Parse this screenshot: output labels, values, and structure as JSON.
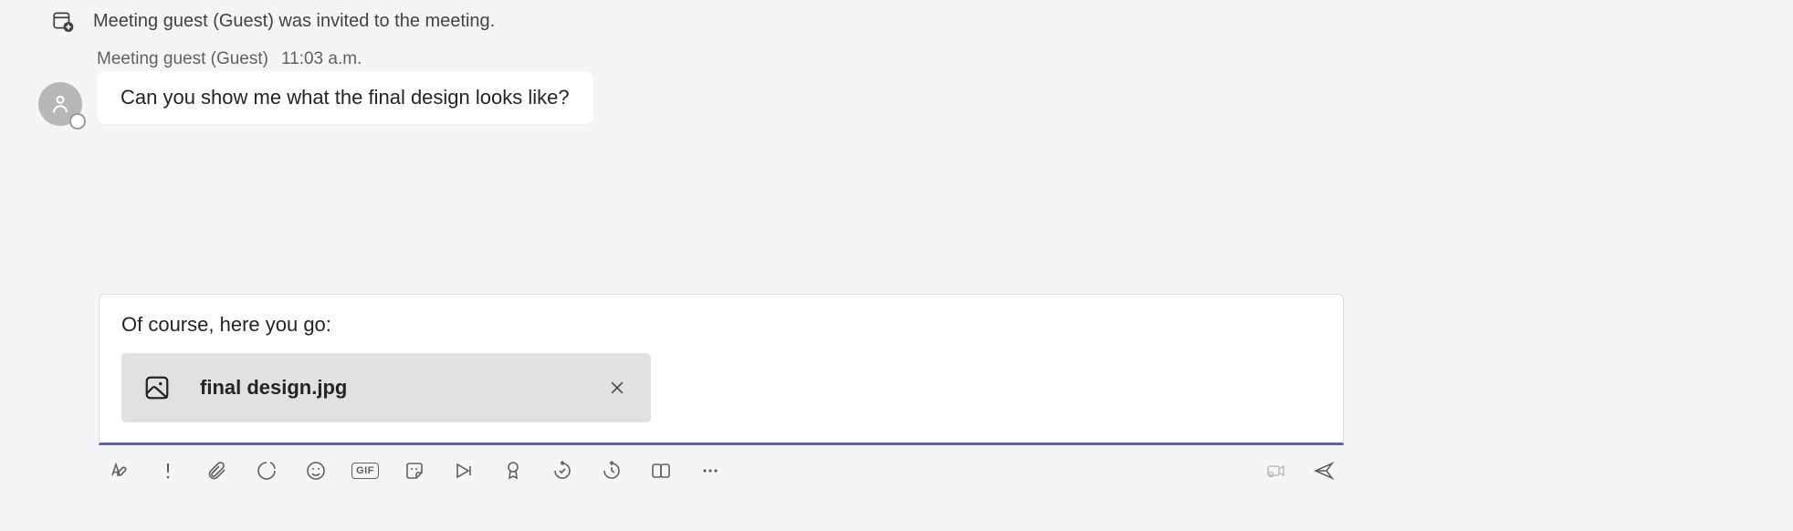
{
  "system": {
    "text": "Meeting guest (Guest) was invited to the meeting."
  },
  "message": {
    "sender": "Meeting guest (Guest)",
    "time": "11:03 a.m.",
    "body": "Can you show me what the final design looks like?"
  },
  "composer": {
    "text": "Of course, here you go:",
    "attachment": {
      "filename": "final design.jpg"
    }
  },
  "toolbar": {
    "gif_label": "GIF"
  }
}
